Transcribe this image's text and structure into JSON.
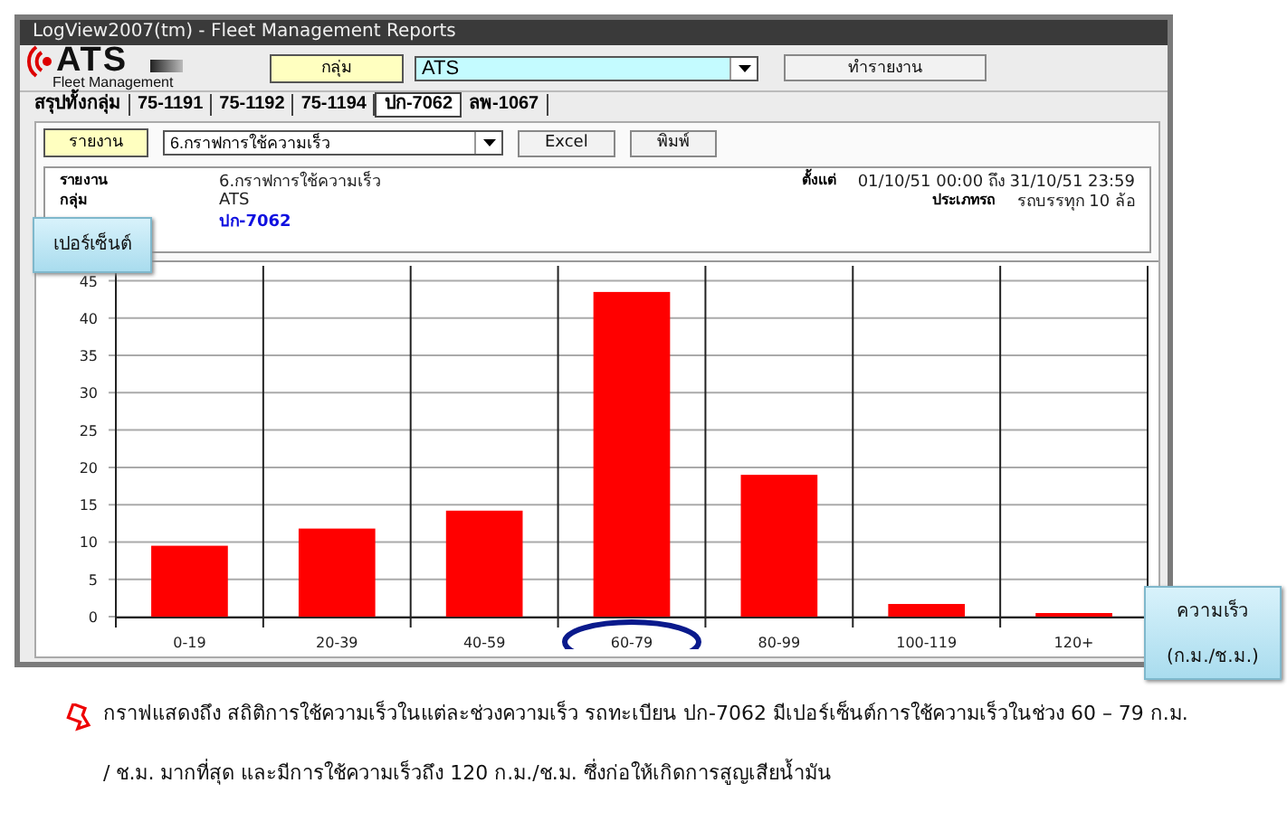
{
  "window": {
    "title": "LogView2007(tm)  - Fleet Management Reports"
  },
  "toolbar": {
    "logo": {
      "name": "ATS",
      "subtitle": "Fleet Management"
    },
    "group_label": "กลุ่ม",
    "group_value": "ATS",
    "run_button": "ทำรายงาน"
  },
  "tabs": [
    {
      "label": "สรุปทั้งกลุ่ม",
      "selected": false
    },
    {
      "label": "75-1191",
      "selected": false
    },
    {
      "label": "75-1192",
      "selected": false
    },
    {
      "label": "75-1194",
      "selected": false
    },
    {
      "label": "ปก-7062",
      "selected": true
    },
    {
      "label": "ลพ-1067",
      "selected": false
    }
  ],
  "report_bar": {
    "label": "รายงาน",
    "report_value": "6.กราฟการใช้ความเร็ว",
    "buttons": [
      "Excel",
      "พิมพ์"
    ]
  },
  "info": {
    "left": [
      {
        "label": "รายงาน",
        "value": "6.กราฟการใช้ความเร็ว",
        "kind": "plain"
      },
      {
        "label": "กลุ่ม",
        "value": "ATS",
        "kind": "plain"
      },
      {
        "value": "ปก-7062",
        "kind": "link"
      }
    ],
    "right": [
      {
        "label": "ตั้งแต่",
        "value": "01/10/51  00:00 ถึง 31/10/51  23:59"
      },
      {
        "label": "ประเภทรถ",
        "value": "รถบรรทุก 10 ล้อ"
      }
    ]
  },
  "chart": {
    "chart_data": {
      "type": "bar",
      "categories": [
        "0-19",
        "20-39",
        "40-59",
        "60-79",
        "80-99",
        "100-119",
        "120+"
      ],
      "ylabel": "เปอร์เซ็นต์",
      "series": [
        {
          "color": "#ff0000",
          "values": [
            9.5,
            11.8,
            14.2,
            43.5,
            19,
            1.7,
            0.3
          ]
        }
      ],
      "ylim": [
        0,
        47
      ],
      "yticks": [
        0,
        5,
        10,
        15,
        20,
        25,
        30,
        35,
        40,
        45
      ],
      "grid": true
    }
  },
  "callouts": {
    "x_axis": [
      "ความเร็ว",
      "(ก.ม./ช.ม.)"
    ]
  },
  "caption": "กราฟแสดงถึง สถิติการใช้ความเร็วในแต่ละช่วงความเร็ว รถทะเบียน ปก-7062 มีเปอร์เซ็นต์การใช้ความเร็วในช่วง 60 – 79 ก.ม. / ช.ม. มากที่สุด และมีการใช้ความเร็วถึง 120 ก.ม./ช.ม. ซึ่งก่อให้เกิดการสูญเสียน้ำมัน"
}
